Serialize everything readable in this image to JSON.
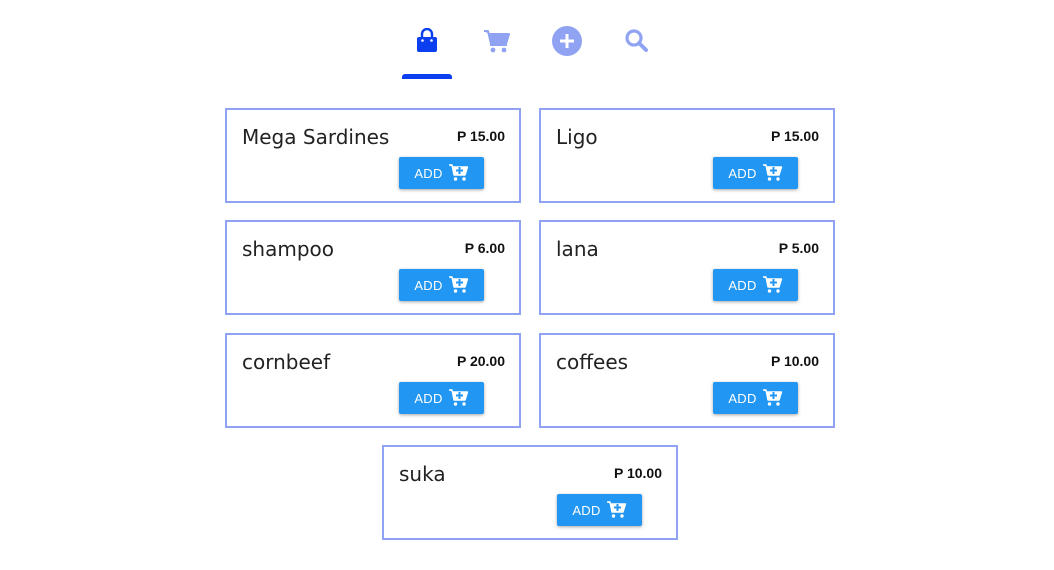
{
  "nav": {
    "tabs": [
      {
        "icon": "shopping-bag-icon",
        "active": true
      },
      {
        "icon": "cart-icon",
        "active": false
      },
      {
        "icon": "add-circle-icon",
        "active": false
      },
      {
        "icon": "search-icon",
        "active": false
      }
    ],
    "active_color": "#0b3ff0",
    "inactive_color": "#8fa3f2"
  },
  "products": [
    {
      "name": "Mega Sardines",
      "price": "P 15.00",
      "button_label": "ADD"
    },
    {
      "name": "Ligo",
      "price": "P 15.00",
      "button_label": "ADD"
    },
    {
      "name": "shampoo",
      "price": "P 6.00",
      "button_label": "ADD"
    },
    {
      "name": "lana",
      "price": "P 5.00",
      "button_label": "ADD"
    },
    {
      "name": "cornbeef",
      "price": "P 20.00",
      "button_label": "ADD"
    },
    {
      "name": "coffees",
      "price": "P 10.00",
      "button_label": "ADD"
    },
    {
      "name": "suka",
      "price": "P 10.00",
      "button_label": "ADD"
    }
  ],
  "colors": {
    "card_border": "#8fa3f2",
    "button": "#2196f3"
  }
}
